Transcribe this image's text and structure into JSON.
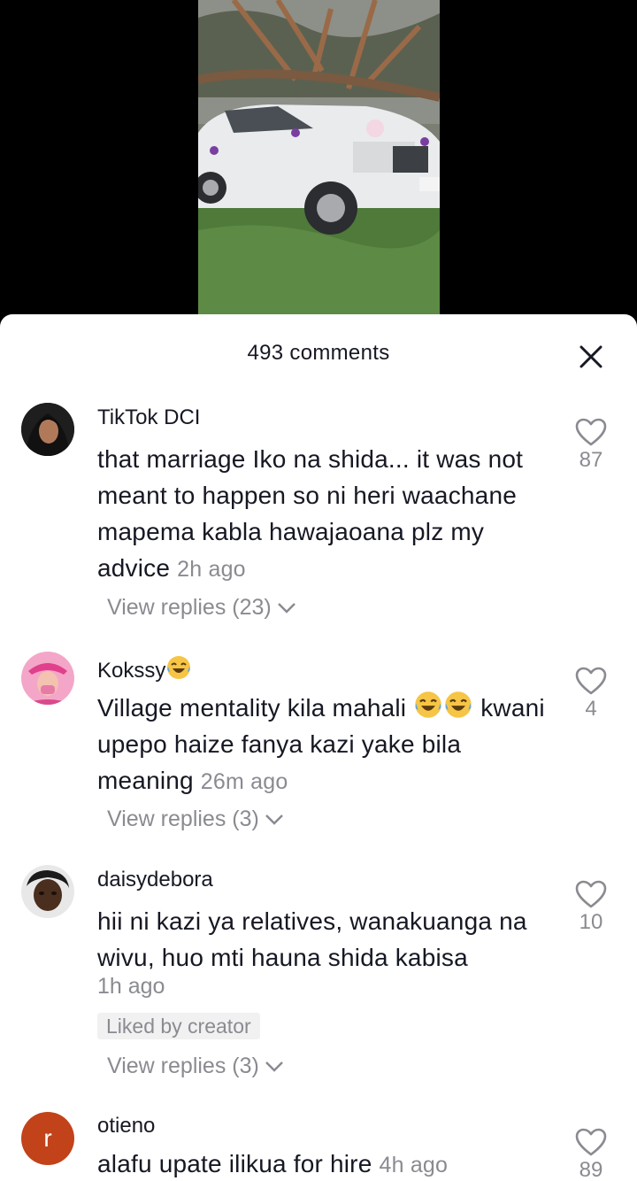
{
  "sheet": {
    "title": "493 comments"
  },
  "comments": [
    {
      "username": "TikTok DCI",
      "text": "that marriage Iko na shida... it was not meant to happen so ni heri waachane mapema kabla hawajaoana plz my advice",
      "time": "2h ago",
      "likes": "87",
      "view_replies": "View replies (23)"
    },
    {
      "username": "Kokssy",
      "text": "Village mentality kila mahali",
      "text_after_emoji": "kwani upepo haize fanya kazi yake bila meaning",
      "time": "26m ago",
      "likes": "4",
      "view_replies": "View replies (3)"
    },
    {
      "username": "daisydebora",
      "text": "hii ni kazi ya relatives, wanakuanga na wivu, huo mti hauna shida kabisa",
      "time": "1h ago",
      "badge": "Liked by creator",
      "likes": "10",
      "view_replies": "View replies (3)"
    },
    {
      "username": "otieno",
      "avatar_letter": "r",
      "text": "alafu upate ilikua for hire",
      "time": "4h ago",
      "likes": "89"
    }
  ],
  "colors": {
    "text_primary": "#161823",
    "text_secondary": "#8a8b91",
    "avatar_orange": "#c2421a",
    "badge_bg": "#f1f1f2"
  },
  "icons": [
    "close-icon",
    "heart-outline-icon",
    "chevron-down-icon",
    "laughing-tears-emoji"
  ]
}
